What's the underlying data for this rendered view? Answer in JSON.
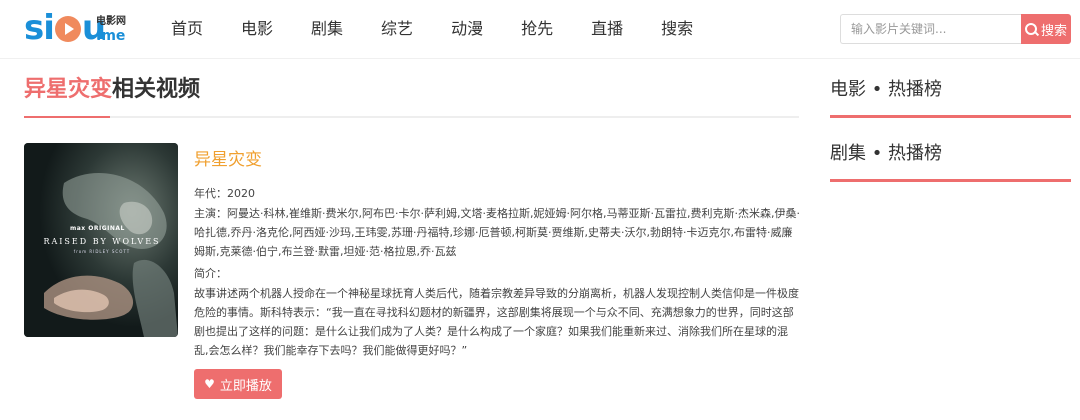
{
  "logo": {
    "main": "sicu",
    "small": "电影网",
    "me": ".me"
  },
  "nav": [
    "首页",
    "电影",
    "剧集",
    "综艺",
    "动漫",
    "抢先",
    "直播",
    "搜索"
  ],
  "search": {
    "placeholder": "输入影片关键词...",
    "button": "搜索"
  },
  "section": {
    "highlight": "异星灾变",
    "rest": "相关视频"
  },
  "movie": {
    "title": "异星灾变",
    "poster_text": {
      "brand": "max ORIGINAL",
      "title": "RAISED BY WOLVES",
      "credit": "from RIDLEY SCOTT"
    },
    "year_label": "年代：",
    "year": "2020",
    "cast_label": "主演：",
    "cast": "阿曼达·科林,崔维斯·费米尔,阿布巴·卡尔·萨利姆,文塔·麦格拉斯,妮娅姆·阿尔格,马蒂亚斯·瓦雷拉,费利克斯·杰米森,伊桑·哈扎德,乔丹·洛克伦,阿西娅·沙玛,王玮雯,苏珊·丹福特,珍娜·厄普顿,柯斯莫·贾维斯,史蒂夫·沃尔,勃朗特·卡迈克尔,布雷特·威廉姆斯,克莱德·伯宁,布兰登·默雷,坦娅·范·格拉恩,乔·瓦兹",
    "intro_label": "简介：",
    "intro": "故事讲述两个机器人授命在一个神秘星球抚育人类后代，随着宗教差异导致的分崩离析，机器人发现控制人类信仰是一件极度危险的事情。斯科特表示：“我一直在寻找科幻题材的新疆界，这部剧集将展现一个与众不同、充满想象力的世界，同时这部剧也提出了这样的问题：是什么让我们成为了人类？是什么构成了一个家庭？如果我们能重新来过、消除我们所在星球的混乱,会怎么样？我们能幸存下去吗？我们能做得更好吗？”",
    "play_button": "立即播放"
  },
  "sidebar": [
    {
      "title": "电影 • 热播榜"
    },
    {
      "title": "剧集 • 热播榜"
    }
  ],
  "colors": {
    "accent": "#ee6e6e",
    "title_orange": "#f0a030",
    "logo_blue": "#1a8fd8"
  }
}
